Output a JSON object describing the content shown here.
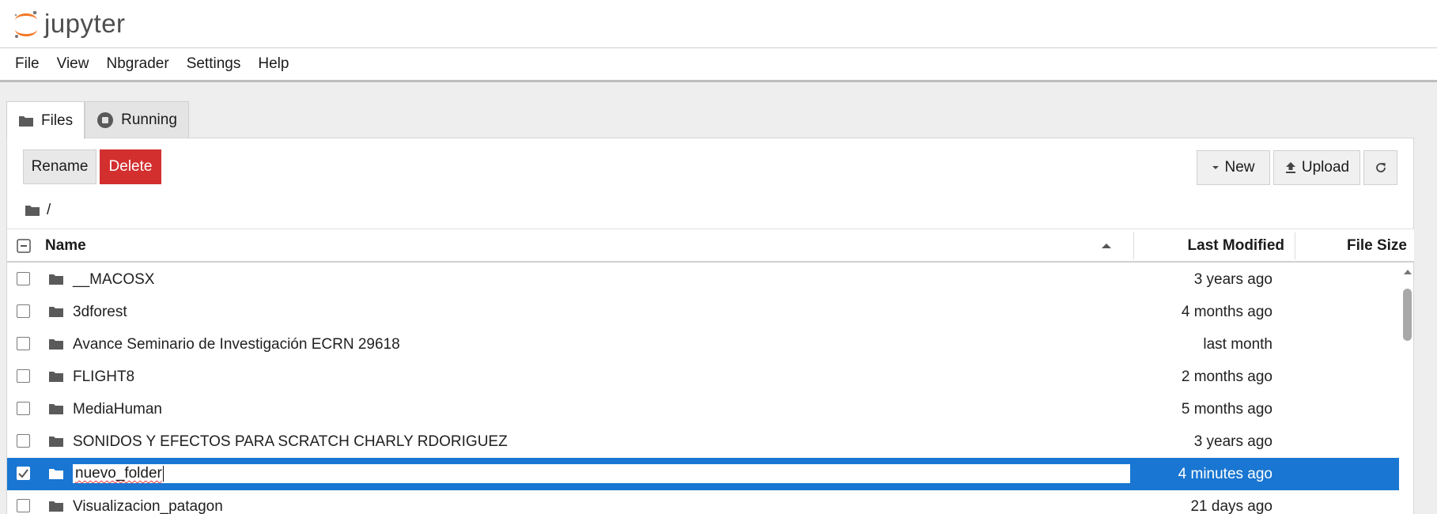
{
  "header": {
    "logo_text": "jupyter"
  },
  "menu": [
    "File",
    "View",
    "Nbgrader",
    "Settings",
    "Help"
  ],
  "tabs": [
    {
      "label": "Files",
      "icon": "folder-icon",
      "active": true
    },
    {
      "label": "Running",
      "icon": "stop-circle-icon",
      "active": false
    }
  ],
  "toolbar": {
    "rename_label": "Rename",
    "delete_label": "Delete",
    "new_label": "New",
    "upload_label": "Upload",
    "refresh_icon": "refresh-icon"
  },
  "breadcrumb": {
    "path": "/"
  },
  "columns": {
    "name": "Name",
    "last_modified": "Last Modified",
    "file_size": "File Size"
  },
  "files": [
    {
      "name": "__MACOSX",
      "modified": "3 years ago",
      "selected": false
    },
    {
      "name": "3dforest",
      "modified": "4 months ago",
      "selected": false
    },
    {
      "name": "Avance Seminario de Investigación ECRN 29618",
      "modified": "last month",
      "selected": false
    },
    {
      "name": "FLIGHT8",
      "modified": "2 months ago",
      "selected": false
    },
    {
      "name": "MediaHuman",
      "modified": "5 months ago",
      "selected": false
    },
    {
      "name": "SONIDOS Y EFECTOS PARA SCRATCH CHARLY RDORIGUEZ",
      "modified": "3 years ago",
      "selected": false
    },
    {
      "name": "nuevo_folder",
      "modified": "4 minutes ago",
      "selected": true,
      "renaming": true
    },
    {
      "name": "Visualizacion_patagon",
      "modified": "21 days ago",
      "selected": false
    }
  ],
  "colors": {
    "accent": "#1976d2",
    "danger": "#d32f2f",
    "logo_orange": "#f37726"
  }
}
